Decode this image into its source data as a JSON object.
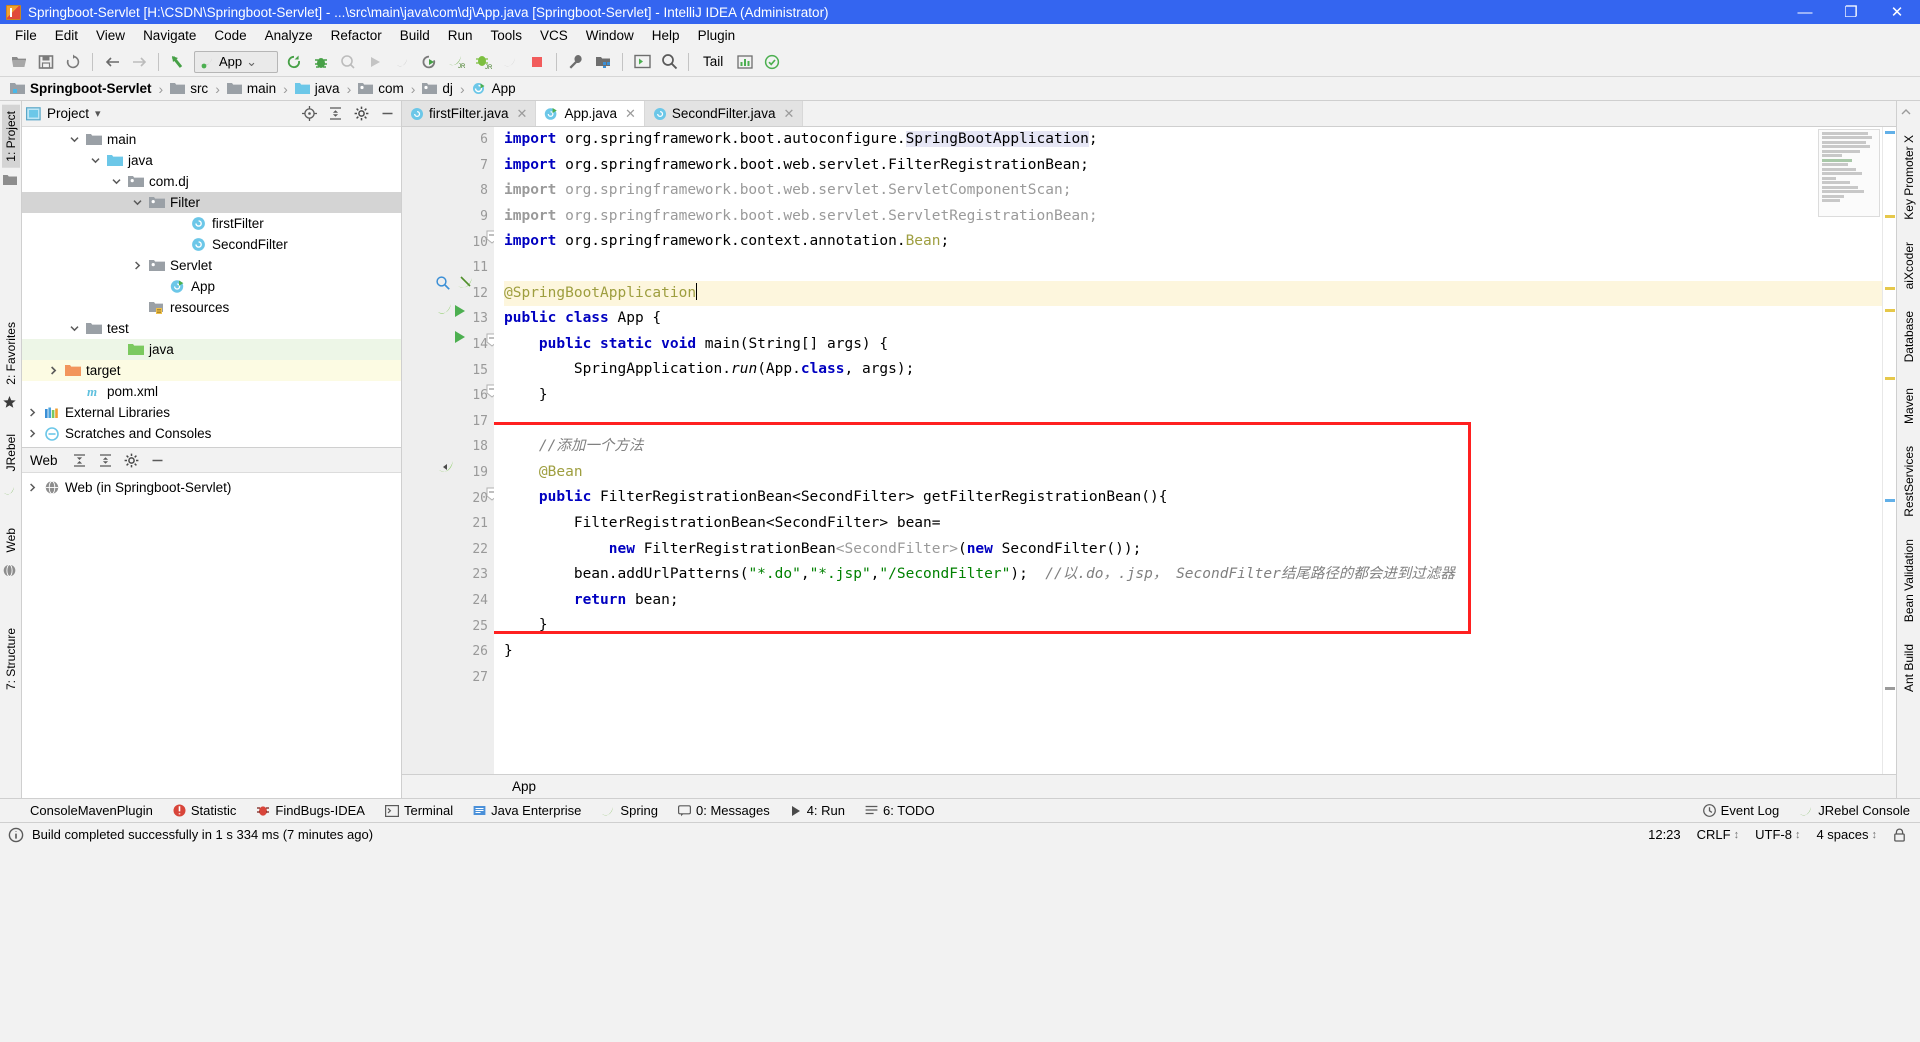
{
  "window": {
    "title": "Springboot-Servlet [H:\\CSDN\\Springboot-Servlet] - ...\\src\\main\\java\\com\\dj\\App.java [Springboot-Servlet] - IntelliJ IDEA (Administrator)",
    "titlebar_color": "#3465f0",
    "minimize": "—",
    "maximize": "❐",
    "close": "✕"
  },
  "menubar": {
    "items": [
      "File",
      "Edit",
      "View",
      "Navigate",
      "Code",
      "Analyze",
      "Refactor",
      "Build",
      "Run",
      "Tools",
      "VCS",
      "Window",
      "Help",
      "Plugin"
    ]
  },
  "toolbar": {
    "run_config": "App",
    "dropdown_caret": "⌄",
    "tail_label": "Tail",
    "icons": [
      "open-folder-icon",
      "save-all-icon",
      "sync-icon",
      "back-arrow-icon",
      "forward-arrow-icon",
      "undo-arrow-icon",
      "run-config-selector",
      "rerun-icon",
      "debug-icon",
      "coverage-icon",
      "run-icon",
      "debug-grey-icon",
      "run-with-coverage-icon",
      "jrebel-run-icon",
      "jrebel-debug-icon",
      "jrebel-grey-icon",
      "stop-icon",
      "settings-wrench-icon",
      "project-structure-icon",
      "terminal-icon",
      "search-everywhere-icon",
      "update-icon"
    ]
  },
  "breadcrumb": {
    "items": [
      {
        "label": "Springboot-Servlet",
        "icon": "module-icon",
        "bold": true
      },
      {
        "label": "src",
        "icon": "folder-icon",
        "bold": false
      },
      {
        "label": "main",
        "icon": "folder-icon",
        "bold": false
      },
      {
        "label": "java",
        "icon": "source-folder-icon",
        "bold": false
      },
      {
        "label": "com",
        "icon": "package-icon",
        "bold": false
      },
      {
        "label": "dj",
        "icon": "package-icon",
        "bold": false
      },
      {
        "label": "App",
        "icon": "spring-class-icon",
        "bold": false
      }
    ],
    "separator": "›"
  },
  "left_rail": {
    "tabs": [
      {
        "label": "1: Project",
        "selected": true
      },
      {
        "label": "2: Favorites",
        "selected": false
      },
      {
        "label": "JRebel",
        "selected": false
      },
      {
        "label": "Web",
        "selected": false
      },
      {
        "label": "7: Structure",
        "selected": false
      }
    ]
  },
  "right_rail": {
    "tabs": [
      "Key Promoter X",
      "aiXcoder",
      "Database",
      "Maven",
      "RestServices",
      "Bean Validation",
      "Ant Build"
    ]
  },
  "project_panel": {
    "title": "Project",
    "dropdown_caret": "▾",
    "actions": [
      "locate-icon",
      "collapse-all-icon",
      "settings-gear-icon",
      "hide-icon"
    ],
    "tree": [
      {
        "label": "main",
        "icon": "folder-icon",
        "indent": 3,
        "twisty": "expanded",
        "state": "normal"
      },
      {
        "label": "java",
        "icon": "source-folder-icon",
        "indent": 4,
        "twisty": "expanded",
        "state": "normal"
      },
      {
        "label": "com.dj",
        "icon": "package-icon",
        "indent": 5,
        "twisty": "expanded",
        "state": "normal"
      },
      {
        "label": "Filter",
        "icon": "package-icon",
        "indent": 6,
        "twisty": "expanded",
        "state": "selected"
      },
      {
        "label": "firstFilter",
        "icon": "class-icon",
        "indent": 8,
        "twisty": "none",
        "state": "normal"
      },
      {
        "label": "SecondFilter",
        "icon": "class-icon",
        "indent": 8,
        "twisty": "none",
        "state": "normal"
      },
      {
        "label": "Servlet",
        "icon": "package-icon",
        "indent": 6,
        "twisty": "collapsed",
        "state": "normal"
      },
      {
        "label": "App",
        "icon": "spring-class-icon",
        "indent": 7,
        "twisty": "none",
        "state": "normal"
      },
      {
        "label": "resources",
        "icon": "resources-folder-icon",
        "indent": 4,
        "twisty": "none",
        "state": "normal"
      },
      {
        "label": "test",
        "icon": "folder-icon",
        "indent": 3,
        "twisty": "expanded",
        "state": "normal"
      },
      {
        "label": "java",
        "icon": "test-source-folder-icon",
        "indent": 5,
        "twisty": "none",
        "state": "green"
      },
      {
        "label": "target",
        "icon": "excluded-folder-icon",
        "indent": 2,
        "twisty": "collapsed",
        "state": "yellow"
      },
      {
        "label": "pom.xml",
        "icon": "maven-icon",
        "indent": 3,
        "twisty": "none",
        "state": "normal"
      },
      {
        "label": "External Libraries",
        "icon": "libraries-icon",
        "indent": 1,
        "twisty": "collapsed",
        "state": "normal"
      },
      {
        "label": "Scratches and Consoles",
        "icon": "scratches-icon",
        "indent": 1,
        "twisty": "collapsed",
        "state": "normal"
      }
    ]
  },
  "web_panel": {
    "title": "Web",
    "actions": [
      "expand-all-icon",
      "collapse-all-icon",
      "settings-gear-icon",
      "hide-icon"
    ],
    "tree": [
      {
        "label": "Web (in Springboot-Servlet)",
        "icon": "web-facet-icon",
        "twisty": "collapsed"
      }
    ]
  },
  "editor": {
    "tabs": [
      {
        "label": "firstFilter.java",
        "icon": "class-icon",
        "active": false,
        "close": "✕"
      },
      {
        "label": "App.java",
        "icon": "spring-class-icon",
        "active": true,
        "close": "✕"
      },
      {
        "label": "SecondFilter.java",
        "icon": "class-icon",
        "active": false,
        "close": "✕"
      }
    ],
    "first_line_number": 6,
    "line_numbers": [
      6,
      7,
      8,
      9,
      10,
      11,
      12,
      13,
      14,
      15,
      16,
      17,
      18,
      19,
      20,
      21,
      22,
      23,
      24,
      25,
      26,
      27
    ],
    "status_text": "App",
    "highlight_box_color": "#ff2020",
    "lines": [
      {
        "n": 6,
        "segments": [
          {
            "t": "import ",
            "c": "k"
          },
          {
            "t": "org.springframework.boot.autoconfigure.",
            "c": ""
          },
          {
            "t": "SpringBootApplication",
            "c": "hlref"
          },
          {
            "t": ";",
            "c": ""
          }
        ]
      },
      {
        "n": 7,
        "segments": [
          {
            "t": "import ",
            "c": "k"
          },
          {
            "t": "org.springframework.boot.web.servlet.FilterRegistrationBean;",
            "c": ""
          }
        ]
      },
      {
        "n": 8,
        "segments": [
          {
            "t": "import ",
            "c": "k-grey"
          },
          {
            "t": "org.springframework.boot.web.servlet.ServletComponentScan;",
            "c": "grey"
          }
        ]
      },
      {
        "n": 9,
        "segments": [
          {
            "t": "import ",
            "c": "k-grey"
          },
          {
            "t": "org.springframework.boot.web.servlet.ServletRegistrationBean;",
            "c": "grey"
          }
        ]
      },
      {
        "n": 10,
        "segments": [
          {
            "t": "import ",
            "c": "k"
          },
          {
            "t": "org.springframework.context.annotation.",
            "c": ""
          },
          {
            "t": "Bean",
            "c": "ann"
          },
          {
            "t": ";",
            "c": ""
          }
        ]
      },
      {
        "n": 11,
        "segments": []
      },
      {
        "n": 12,
        "segments": [
          {
            "t": "@SpringBootApplication",
            "c": "ann"
          }
        ],
        "highlighted": true,
        "caret": true
      },
      {
        "n": 13,
        "segments": [
          {
            "t": "public class ",
            "c": "k"
          },
          {
            "t": "App {",
            "c": ""
          }
        ]
      },
      {
        "n": 14,
        "segments": [
          {
            "t": "    ",
            "c": ""
          },
          {
            "t": "public static void ",
            "c": "k"
          },
          {
            "t": "main(String[] args) {",
            "c": ""
          }
        ]
      },
      {
        "n": 15,
        "segments": [
          {
            "t": "        SpringApplication.",
            "c": ""
          },
          {
            "t": "run",
            "c": "ital"
          },
          {
            "t": "(App.",
            "c": ""
          },
          {
            "t": "class",
            "c": "k"
          },
          {
            "t": ", args);",
            "c": ""
          }
        ]
      },
      {
        "n": 16,
        "segments": [
          {
            "t": "    }",
            "c": ""
          }
        ]
      },
      {
        "n": 17,
        "segments": []
      },
      {
        "n": 18,
        "segments": [
          {
            "t": "    //添加一个方法",
            "c": "com"
          }
        ]
      },
      {
        "n": 19,
        "segments": [
          {
            "t": "    @Bean",
            "c": "ann"
          }
        ]
      },
      {
        "n": 20,
        "segments": [
          {
            "t": "    ",
            "c": ""
          },
          {
            "t": "public ",
            "c": "k"
          },
          {
            "t": "FilterRegistrationBean<SecondFilter> getFilterRegistrationBean(){",
            "c": ""
          }
        ]
      },
      {
        "n": 21,
        "segments": [
          {
            "t": "        FilterRegistrationBean<SecondFilter> bean=",
            "c": ""
          }
        ]
      },
      {
        "n": 22,
        "segments": [
          {
            "t": "            ",
            "c": ""
          },
          {
            "t": "new ",
            "c": "k"
          },
          {
            "t": "FilterRegistrationBean",
            "c": ""
          },
          {
            "t": "<SecondFilter>",
            "c": "grey"
          },
          {
            "t": "(",
            "c": ""
          },
          {
            "t": "new ",
            "c": "k"
          },
          {
            "t": "SecondFilter());",
            "c": ""
          }
        ]
      },
      {
        "n": 23,
        "segments": [
          {
            "t": "        bean.addUrlPatterns(",
            "c": ""
          },
          {
            "t": "\"*.do\"",
            "c": "str"
          },
          {
            "t": ",",
            "c": ""
          },
          {
            "t": "\"*.jsp\"",
            "c": "str"
          },
          {
            "t": ",",
            "c": ""
          },
          {
            "t": "\"/SecondFilter\"",
            "c": "str"
          },
          {
            "t": ");  ",
            "c": ""
          },
          {
            "t": "//以.do，.jsp， SecondFilter结尾路径的都会进到过滤器",
            "c": "com"
          }
        ]
      },
      {
        "n": 24,
        "segments": [
          {
            "t": "        ",
            "c": ""
          },
          {
            "t": "return ",
            "c": "k"
          },
          {
            "t": "bean;",
            "c": ""
          }
        ]
      },
      {
        "n": 25,
        "segments": [
          {
            "t": "    }",
            "c": ""
          }
        ]
      },
      {
        "n": 26,
        "segments": [
          {
            "t": "}",
            "c": ""
          }
        ]
      },
      {
        "n": 27,
        "segments": []
      }
    ]
  },
  "toolwindow_bar": {
    "items": [
      {
        "label": "ConsoleMavenPlugin",
        "icon": "none"
      },
      {
        "label": "Statistic",
        "icon": "statistic-icon"
      },
      {
        "label": "FindBugs-IDEA",
        "icon": "findbugs-icon"
      },
      {
        "label": "Terminal",
        "icon": "terminal-icon"
      },
      {
        "label": "Java Enterprise",
        "icon": "java-enterprise-icon"
      },
      {
        "label": "Spring",
        "icon": "spring-icon"
      },
      {
        "label": "0: Messages",
        "icon": "messages-icon"
      },
      {
        "label": "4: Run",
        "icon": "run-icon"
      },
      {
        "label": "6: TODO",
        "icon": "todo-icon"
      }
    ],
    "right_items": [
      {
        "label": "Event Log",
        "icon": "event-log-icon"
      },
      {
        "label": "JRebel Console",
        "icon": "jrebel-icon"
      }
    ]
  },
  "statusbar": {
    "build_icon": "info-icon",
    "message": "Build completed successfully in 1 s 334 ms (7 minutes ago)",
    "time": "12:23",
    "line_separator": "CRLF",
    "encoding": "UTF-8",
    "indent": "4 spaces",
    "caret": "↕",
    "lock_icon": "lock-icon"
  }
}
